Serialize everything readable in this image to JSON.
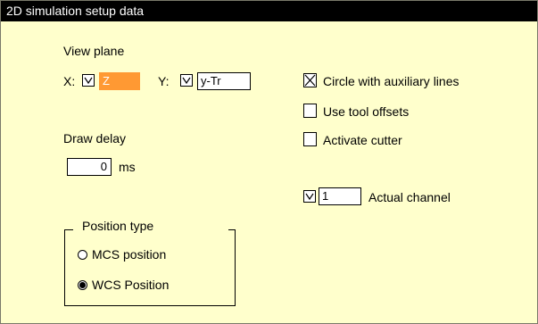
{
  "title": "2D simulation setup data",
  "view_plane": {
    "label": "View plane",
    "x_label": "X:",
    "x_value": "Z",
    "y_label": "Y:",
    "y_value": "y-Tr"
  },
  "draw_delay": {
    "label": "Draw delay",
    "value": "0",
    "unit": "ms"
  },
  "position_type": {
    "label": "Position type",
    "options": [
      {
        "label": "MCS position",
        "selected": false
      },
      {
        "label": "WCS Position",
        "selected": true
      }
    ]
  },
  "options": {
    "circle_aux": {
      "label": "Circle with auxiliary lines",
      "checked": true
    },
    "tool_offsets": {
      "label": "Use tool offsets",
      "checked": false
    },
    "activate_cutter": {
      "label": "Activate cutter",
      "checked": false
    }
  },
  "channel": {
    "value": "1",
    "label": "Actual channel"
  },
  "colors": {
    "background": "#ffffcc",
    "titlebar": "#000000",
    "active_field": "#ff9933"
  },
  "icons": [
    "toggle-icon",
    "checkbox-checked-icon",
    "checkbox-empty-icon",
    "radio-icon"
  ]
}
